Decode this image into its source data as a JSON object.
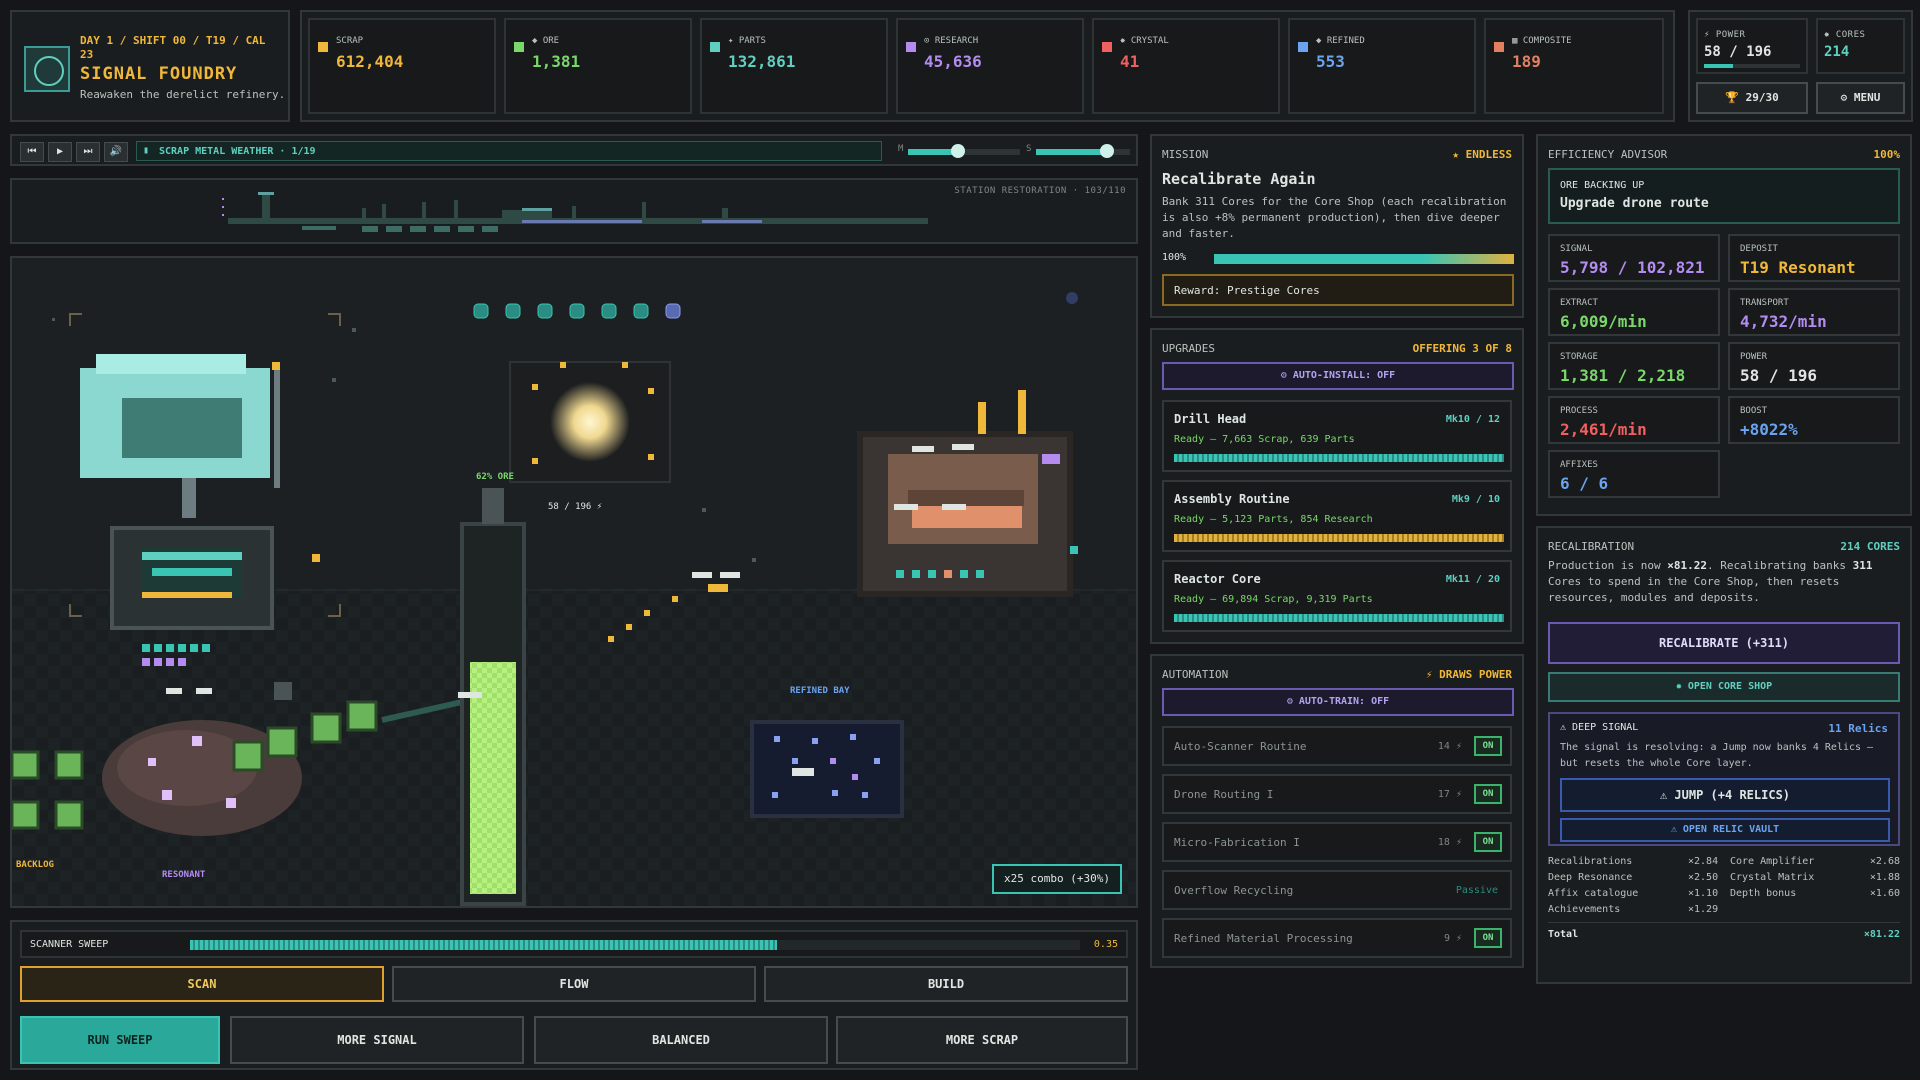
{
  "header": {
    "day_line1": "DAY 1 / SHIFT 00 / T19 / CAL",
    "day_line2": "23",
    "title": "SIGNAL FOUNDRY",
    "subtitle": "Reawaken the derelict refinery."
  },
  "resources": [
    {
      "name": "SCRAP",
      "value": "612,404",
      "color": "#f0b83a"
    },
    {
      "name": "◆ ORE",
      "value": "1,381",
      "color": "#7ad86a"
    },
    {
      "name": "✦ PARTS",
      "value": "132,861",
      "color": "#5fd0c0"
    },
    {
      "name": "⊙ RESEARCH",
      "value": "45,636",
      "color": "#b48cf0"
    },
    {
      "name": "✸ CRYSTAL",
      "value": "41",
      "color": "#f06060"
    },
    {
      "name": "◆ REFINED",
      "value": "553",
      "color": "#6aa4f0"
    },
    {
      "name": "▦ COMPOSITE",
      "value": "189",
      "color": "#e08060"
    }
  ],
  "power_panel": {
    "power_label": "⚡ POWER",
    "power_value": "58 / 196",
    "power_fill": 0.296,
    "cores_label": "✸ CORES",
    "cores_value": "214",
    "trophy": "🏆 29/30",
    "menu": "⚙ MENU"
  },
  "transport": {
    "track": "SCRAP METAL WEATHER · 1/19",
    "music_label": "M",
    "sfx_label": "S",
    "music_level": 0.45,
    "sfx_level": 0.75
  },
  "station": {
    "label": "STATION RESTORATION · 103/110"
  },
  "scene": {
    "ore_pct": "62% ORE",
    "power_mid": "58 / 196 ⚡",
    "refined_bay": "REFINED BAY",
    "backlog": "BACKLOG",
    "resonant": "RESONANT",
    "combo": "x25 combo (+30%)"
  },
  "controls": {
    "sweep_label": "SCANNER SWEEP",
    "sweep_value": "0.35",
    "sweep_fill": 0.66,
    "tabs": [
      "SCAN",
      "FLOW",
      "BUILD"
    ],
    "actions": [
      "RUN SWEEP",
      "MORE SIGNAL",
      "BALANCED",
      "MORE SCRAP"
    ]
  },
  "mission": {
    "header": "MISSION",
    "badge": "★ ENDLESS",
    "title": "Recalibrate Again",
    "desc": "Bank 311 Cores for the Core Shop (each recalibration is also +8% permanent production), then dive deeper and faster.",
    "pct": "100%",
    "progress": 1.0,
    "reward": "Reward: Prestige Cores"
  },
  "upgrades": {
    "header": "UPGRADES",
    "offering": "OFFERING 3 OF 8",
    "auto_install": "⚙ AUTO-INSTALL: OFF",
    "items": [
      {
        "name": "Drill Head",
        "level": "Mk10 / 12",
        "cost": "Ready — 7,663 Scrap, 639 Parts",
        "fill": 1.0,
        "color": "#3ac4b4"
      },
      {
        "name": "Assembly Routine",
        "level": "Mk9 / 10",
        "cost": "Ready — 5,123 Parts, 854 Research",
        "fill": 1.0,
        "color": "#e0b040"
      },
      {
        "name": "Reactor Core",
        "level": "Mk11 / 20",
        "cost": "Ready — 69,894 Scrap, 9,319 Parts",
        "fill": 1.0,
        "color": "#3ac4b4"
      }
    ]
  },
  "automation": {
    "header": "AUTOMATION",
    "draws": "⚡ DRAWS POWER",
    "auto_train": "⚙ AUTO-TRAIN: OFF",
    "items": [
      {
        "name": "Auto-Scanner Routine",
        "cost": "14 ⚡",
        "state": "ON"
      },
      {
        "name": "Drone Routing I",
        "cost": "17 ⚡",
        "state": "ON"
      },
      {
        "name": "Micro-Fabrication I",
        "cost": "18 ⚡",
        "state": "ON"
      },
      {
        "name": "Overflow Recycling",
        "cost": "Passive",
        "state": ""
      },
      {
        "name": "Refined Material Processing",
        "cost": "9 ⚡",
        "state": "ON"
      }
    ]
  },
  "advisor": {
    "header": "EFFICIENCY ADVISOR",
    "pct": "100%",
    "tip_label": "ORE BACKING UP",
    "tip": "Upgrade drone route",
    "stats": [
      {
        "k": "SIGNAL",
        "v": "5,798 / 102,821",
        "color": "#b48cf0"
      },
      {
        "k": "DEPOSIT",
        "v": "T19 Resonant",
        "color": "#f0b83a"
      },
      {
        "k": "EXTRACT",
        "v": "6,009/min",
        "color": "#7ad86a"
      },
      {
        "k": "TRANSPORT",
        "v": "4,732/min",
        "color": "#b48cf0"
      },
      {
        "k": "STORAGE",
        "v": "1,381 / 2,218",
        "color": "#7ad86a"
      },
      {
        "k": "POWER",
        "v": "58 / 196",
        "color": "#dfe6e2"
      },
      {
        "k": "PROCESS",
        "v": "2,461/min",
        "color": "#f06060"
      },
      {
        "k": "BOOST",
        "v": "+8022%",
        "color": "#6aa4f0"
      },
      {
        "k": "AFFIXES",
        "v": "6 / 6",
        "color": "#6aa4f0"
      }
    ]
  },
  "recal": {
    "header": "RECALIBRATION",
    "cores": "214 CORES",
    "desc_a": "Production is now ",
    "desc_mult": "×81.22",
    "desc_b": ". Recalibrating banks ",
    "desc_banks": "311",
    "desc_c": " Cores to spend in the Core Shop, then resets resources, modules and deposits.",
    "recal_btn": "RECALIBRATE (+311)",
    "core_shop": "✸ OPEN CORE SHOP",
    "deep_label": "⚠ DEEP SIGNAL",
    "relics": "11 Relics",
    "deep_desc": "The signal is resolving: a Jump now banks 4 Relics — but resets the whole Core layer.",
    "jump": "⚠ JUMP (+4 RELICS)",
    "vault": "⚠ OPEN RELIC VAULT",
    "mults": [
      {
        "k": "Recalibrations",
        "v": "×2.84",
        "k2": "Core Amplifier",
        "v2": "×2.68"
      },
      {
        "k": "Deep Resonance",
        "v": "×2.50",
        "k2": "Crystal Matrix",
        "v2": "×1.88"
      },
      {
        "k": "Affix catalogue",
        "v": "×1.10",
        "k2": "Depth bonus",
        "v2": "×1.60"
      },
      {
        "k": "Achievements",
        "v": "×1.29",
        "k2": "",
        "v2": ""
      }
    ],
    "total_label": "Total",
    "total": "×81.22"
  }
}
